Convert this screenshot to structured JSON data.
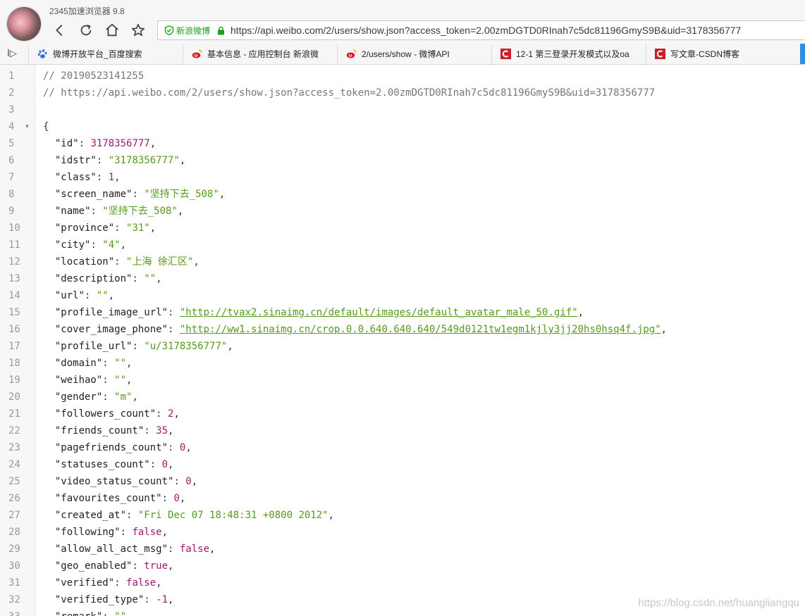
{
  "window": {
    "app_title": "2345加速浏览器 9.8"
  },
  "toolbar": {
    "back_icon": "back-arrow-icon",
    "refresh_icon": "refresh-icon",
    "home_icon": "home-icon",
    "favorite_icon": "star-icon"
  },
  "address_bar": {
    "secure_label": "新浪微博",
    "url": "https://api.weibo.com/2/users/show.json?access_token=2.00zmDGTD0RInah7c5dc81196GmyS9B&uid=3178356777"
  },
  "bookmarks": {
    "toggle_glyph": "I▷",
    "items": [
      {
        "label": "微博开放平台_百度搜索",
        "icon": "baidu-paw-icon"
      },
      {
        "label": "基本信息 - 应用控制台 新浪微",
        "icon": "weibo-icon"
      },
      {
        "label": "2/users/show - 微博API",
        "icon": "weibo-icon"
      },
      {
        "label": "12-1 第三登录开发模式以及oa",
        "icon": "csdn-icon"
      },
      {
        "label": "写文章-CSDN博客",
        "icon": "csdn-icon"
      }
    ]
  },
  "colors": {
    "string": "#57991a",
    "number": "#a0196b",
    "secure": "#1aa01a"
  },
  "code": {
    "comments": [
      "// 20190523141255",
      "// https://api.weibo.com/2/users/show.json?access_token=2.00zmDGTD0RInah7c5dc81196GmyS9B&uid=3178356777"
    ],
    "open_brace": "{",
    "fields": [
      {
        "key": "\"id\"",
        "value": "3178356777",
        "type": "num"
      },
      {
        "key": "\"idstr\"",
        "value": "\"3178356777\"",
        "type": "str"
      },
      {
        "key": "\"class\"",
        "value": "1",
        "type": "num"
      },
      {
        "key": "\"screen_name\"",
        "value": "\"坚持下去_508\"",
        "type": "str"
      },
      {
        "key": "\"name\"",
        "value": "\"坚持下去_508\"",
        "type": "str"
      },
      {
        "key": "\"province\"",
        "value": "\"31\"",
        "type": "str"
      },
      {
        "key": "\"city\"",
        "value": "\"4\"",
        "type": "str"
      },
      {
        "key": "\"location\"",
        "value": "\"上海 徐汇区\"",
        "type": "str"
      },
      {
        "key": "\"description\"",
        "value": "\"\"",
        "type": "str"
      },
      {
        "key": "\"url\"",
        "value": "\"\"",
        "type": "str"
      },
      {
        "key": "\"profile_image_url\"",
        "value": "\"http://tvax2.sinaimg.cn/default/images/default_avatar_male_50.gif\"",
        "type": "link"
      },
      {
        "key": "\"cover_image_phone\"",
        "value": "\"http://ww1.sinaimg.cn/crop.0.0.640.640.640/549d0121tw1egm1kjly3jj20hs0hsq4f.jpg\"",
        "type": "link"
      },
      {
        "key": "\"profile_url\"",
        "value": "\"u/3178356777\"",
        "type": "str"
      },
      {
        "key": "\"domain\"",
        "value": "\"\"",
        "type": "str"
      },
      {
        "key": "\"weihao\"",
        "value": "\"\"",
        "type": "str"
      },
      {
        "key": "\"gender\"",
        "value": "\"m\"",
        "type": "str"
      },
      {
        "key": "\"followers_count\"",
        "value": "2",
        "type": "num"
      },
      {
        "key": "\"friends_count\"",
        "value": "35",
        "type": "num"
      },
      {
        "key": "\"pagefriends_count\"",
        "value": "0",
        "type": "num"
      },
      {
        "key": "\"statuses_count\"",
        "value": "0",
        "type": "num"
      },
      {
        "key": "\"video_status_count\"",
        "value": "0",
        "type": "num"
      },
      {
        "key": "\"favourites_count\"",
        "value": "0",
        "type": "num"
      },
      {
        "key": "\"created_at\"",
        "value": "\"Fri Dec 07 18:48:31 +0800 2012\"",
        "type": "str"
      },
      {
        "key": "\"following\"",
        "value": "false",
        "type": "lit"
      },
      {
        "key": "\"allow_all_act_msg\"",
        "value": "false",
        "type": "lit"
      },
      {
        "key": "\"geo_enabled\"",
        "value": "true",
        "type": "lit"
      },
      {
        "key": "\"verified\"",
        "value": "false",
        "type": "lit"
      },
      {
        "key": "\"verified_type\"",
        "value": "-1",
        "type": "num"
      },
      {
        "key": "\"remark\"",
        "value": "\"\"",
        "type": "str"
      }
    ]
  },
  "watermark": "https://blog.csdn.net/huangliangqu"
}
